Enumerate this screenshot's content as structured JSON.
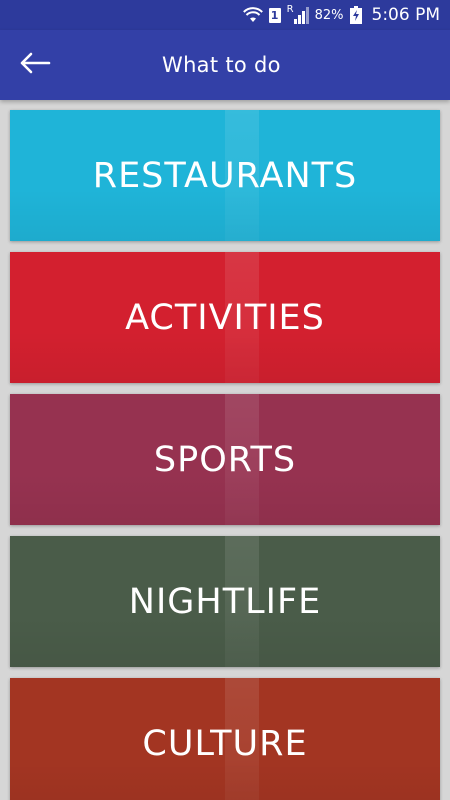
{
  "status_bar": {
    "battery": "82%",
    "time": "5:06 PM",
    "sim_label": "1",
    "roaming_label": "R"
  },
  "app_bar": {
    "title": "What to do",
    "back_icon": "arrow-left-icon"
  },
  "categories": [
    {
      "label": "RESTAURANTS",
      "color": "#1fb4d8"
    },
    {
      "label": "ACTIVITIES",
      "color": "#d3202f"
    },
    {
      "label": "SPORTS",
      "color": "#963250"
    },
    {
      "label": "NIGHTLIFE",
      "color": "#4a5c49"
    },
    {
      "label": "CULTURE",
      "color": "#a33522"
    }
  ],
  "colors": {
    "status_bar": "#2d3a9c",
    "app_bar": "#3340a7",
    "background": "#d6d6d6"
  }
}
